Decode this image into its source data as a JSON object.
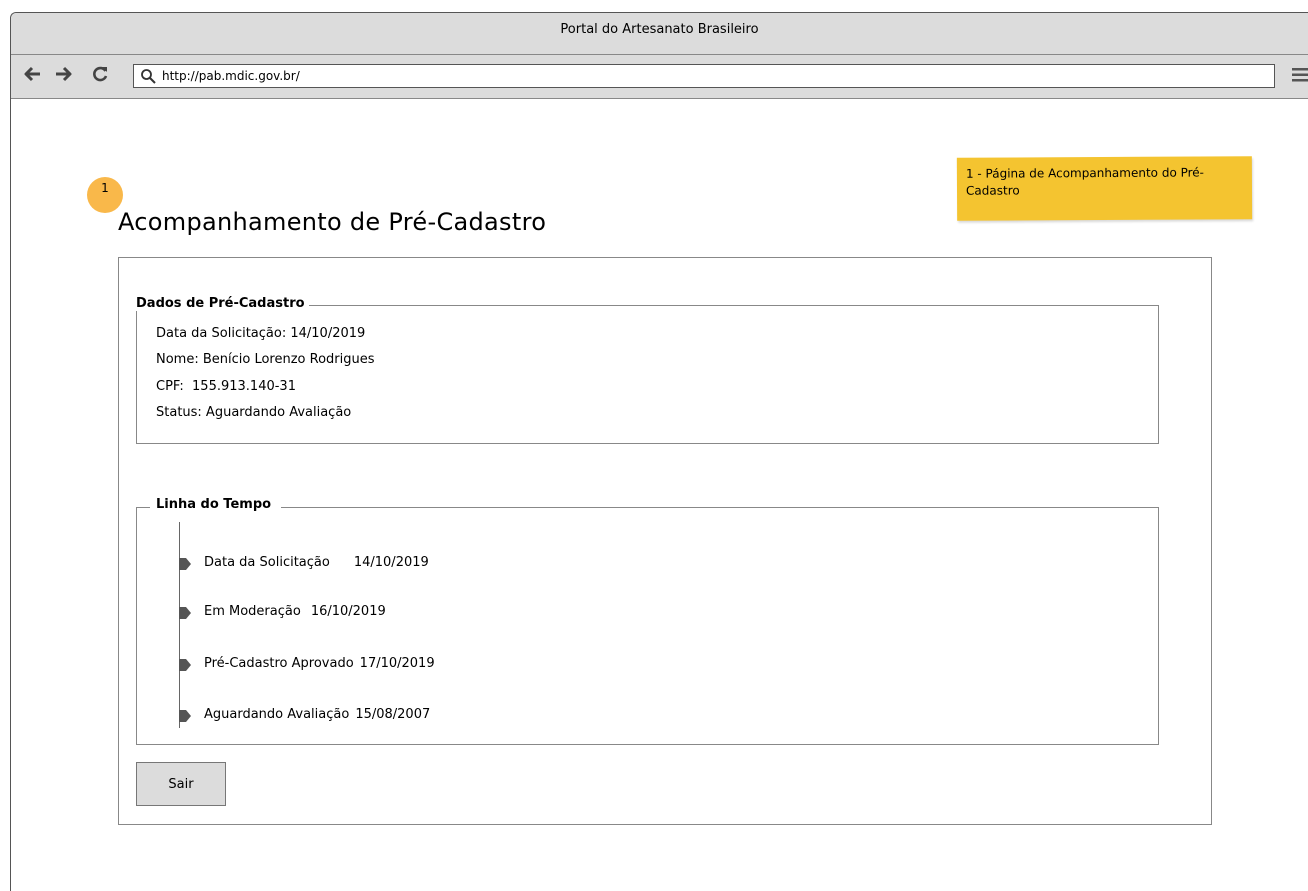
{
  "window": {
    "title": "Portal do Artesanato Brasileiro"
  },
  "toolbar": {
    "back_icon": "arrow-left-icon",
    "forward_icon": "arrow-right-icon",
    "reload_icon": "reload-icon",
    "url": "http://pab.mdic.gov.br/",
    "menu_icon": "hamburger-menu-icon"
  },
  "annotation": {
    "note": "1 - Página de Acompanhamento do Pré-Cadastro",
    "badge": "1",
    "note_color": "#f4c430",
    "badge_color": "#f9b84a"
  },
  "page": {
    "title": "Acompanhamento de Pré-Cadastro"
  },
  "pre_registration": {
    "legend": "Dados de Pré-Cadastro",
    "rows": [
      "Data da Solicitação: 14/10/2019",
      "Nome: Benício Lorenzo Rodrigues",
      "CPF:  155.913.140-31",
      "Status: Aguardando Avaliação"
    ]
  },
  "timeline": {
    "legend": "Linha do Tempo",
    "items": [
      {
        "label": "Data da Solicitação",
        "date": "14/10/2019"
      },
      {
        "label": "Em Moderação",
        "date": "16/10/2019"
      },
      {
        "label": "Pré-Cadastro Aprovado",
        "date": "17/10/2019"
      },
      {
        "label": "Aguardando Avaliação",
        "date": "15/08/2007"
      }
    ]
  },
  "actions": {
    "exit_label": "Sair"
  }
}
